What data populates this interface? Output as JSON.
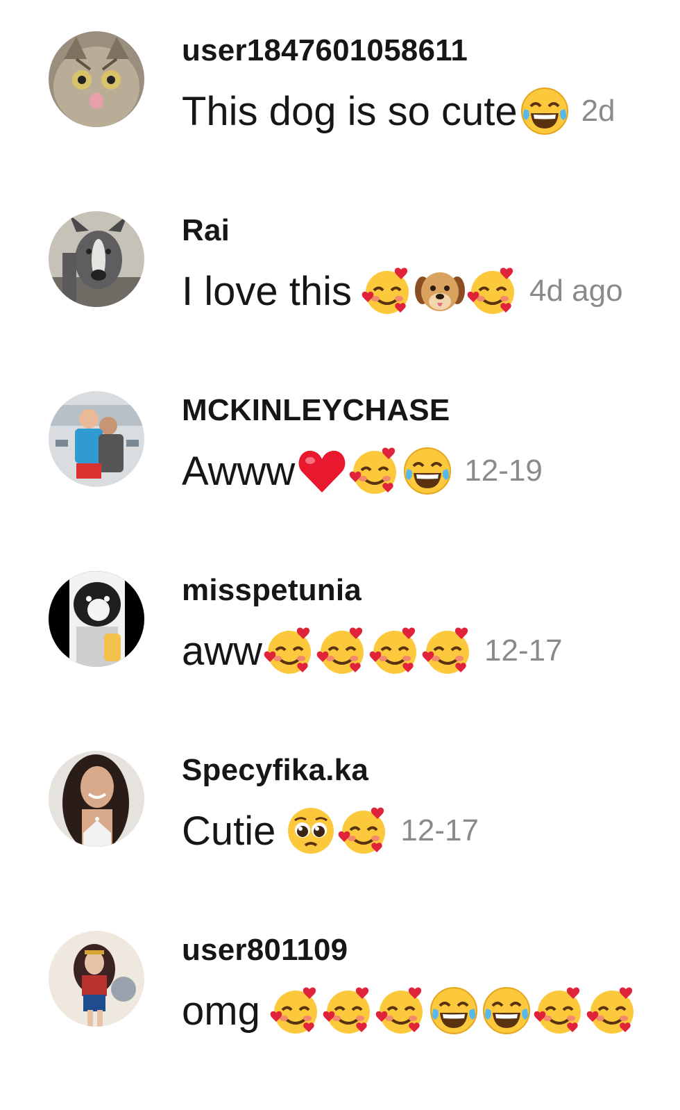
{
  "comments": [
    {
      "username": "user1847601058611",
      "text": "This dog is so cute",
      "emojis": [
        "joy"
      ],
      "time": "2d",
      "avatar": "cat-avatar",
      "gap": false
    },
    {
      "username": "Rai",
      "text": "I love this",
      "emojis": [
        "smiling-hearts",
        "dog",
        "smiling-hearts"
      ],
      "time": "4d ago",
      "avatar": "dog-avatar",
      "gap": true
    },
    {
      "username": "MCKINLEYCHASE",
      "text": "Awww",
      "emojis": [
        "heart",
        "smiling-hearts",
        "joy"
      ],
      "time": "12-19",
      "avatar": "people-avatar",
      "gap": false
    },
    {
      "username": "misspetunia",
      "text": "aww",
      "emojis": [
        "smiling-hearts",
        "smiling-hearts",
        "smiling-hearts",
        "smiling-hearts"
      ],
      "time": "12-17",
      "avatar": "bulldog-avatar",
      "gap": false
    },
    {
      "username": "Specyfika.ka",
      "text": "Cutie",
      "emojis": [
        "pleading",
        "smiling-hearts"
      ],
      "time": "12-17",
      "avatar": "woman-avatar",
      "gap": true
    },
    {
      "username": "user801109",
      "text": "omg",
      "emojis": [
        "smiling-hearts",
        "smiling-hearts",
        "smiling-hearts",
        "joy",
        "joy",
        "smiling-hearts",
        "smiling-hearts"
      ],
      "time": "",
      "avatar": "heroine-avatar",
      "gap": true
    }
  ],
  "colors": {
    "text": "#161616",
    "timestamp": "#8a8a8a",
    "background": "#ffffff"
  }
}
